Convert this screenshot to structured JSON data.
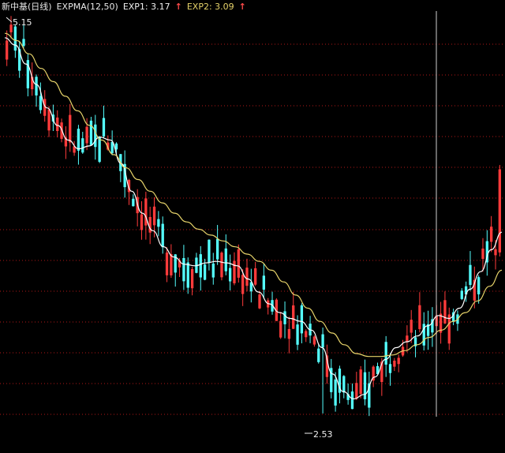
{
  "header": {
    "stock_name": "新中基(日线)",
    "indicator": "EXPMA(12,50)",
    "exp1_label": "EXP1: 3.17",
    "exp2_label": "EXP2: 3.09",
    "up_arrow": "↑"
  },
  "annotations": {
    "high_marker": "5.15",
    "low_marker": "2.53"
  },
  "colors": {
    "background": "#000000",
    "up_candle": "#ff3b3b",
    "down_candle": "#54ffff",
    "exp1_line": "#ffffff",
    "exp2_line": "#e6d36a",
    "grid": "#b01818",
    "crosshair": "#cfcfcf"
  },
  "chart_data": {
    "type": "line",
    "title": "新中基(日线)",
    "ylim": [
      2.4,
      5.25
    ],
    "grid": true,
    "series": [
      {
        "name": "EXP1",
        "values": [
          5.1,
          5.05,
          4.92,
          4.78,
          4.62,
          4.5,
          4.4,
          4.34,
          4.36,
          4.42,
          4.4,
          4.24,
          4.05,
          3.9,
          3.78,
          3.67,
          3.6,
          3.55,
          3.54,
          3.56,
          3.57,
          3.56,
          3.54,
          3.45,
          3.36,
          3.28,
          3.22,
          3.18,
          3.16,
          3.1,
          2.98,
          2.8,
          2.68,
          2.63,
          2.66,
          2.78,
          2.9,
          2.98,
          3.02,
          3.06,
          3.13,
          3.2,
          3.18,
          3.25,
          3.38,
          3.5,
          3.65,
          3.77
        ]
      },
      {
        "name": "EXP2",
        "values": [
          5.13,
          5.08,
          4.99,
          4.89,
          4.8,
          4.7,
          4.6,
          4.5,
          4.4,
          4.3,
          4.21,
          4.13,
          4.05,
          3.97,
          3.9,
          3.84,
          3.79,
          3.75,
          3.71,
          3.67,
          3.62,
          3.57,
          3.51,
          3.43,
          3.34,
          3.25,
          3.16,
          3.08,
          3.0,
          2.94,
          2.92,
          2.92,
          2.93,
          2.96,
          3.0,
          3.05,
          3.1,
          3.16,
          3.22,
          3.3,
          3.4,
          3.51
        ]
      }
    ],
    "candles": {
      "count": 118,
      "high": 5.15,
      "low": 2.53,
      "last_close": 4.2
    }
  }
}
